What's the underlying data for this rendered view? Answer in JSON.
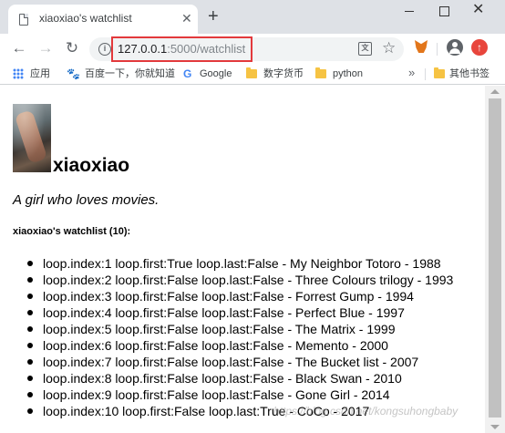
{
  "browser": {
    "tab": {
      "title": "xiaoxiao's watchlist",
      "close_glyph": "✕"
    },
    "new_tab_glyph": "+",
    "window": {
      "close_glyph": "✕"
    },
    "nav": {
      "back": "←",
      "forward": "→",
      "reload": "↻"
    },
    "address": {
      "host": "127.0.0.1",
      "path": ":5000/watchlist",
      "info_glyph": "i"
    },
    "translate_glyph": "文",
    "star_glyph": "☆",
    "update_glyph": "↑"
  },
  "bookmarks": {
    "items": [
      {
        "label": "应用",
        "icon": "apps-icon"
      },
      {
        "label": "百度一下，你就知道",
        "icon": "baidu-paw-icon",
        "glyph": "🐾"
      },
      {
        "label": "Google",
        "icon": "google-icon",
        "glyph": "G"
      },
      {
        "label": "数字货币",
        "icon": "folder-icon"
      },
      {
        "label": "python",
        "icon": "folder-icon"
      }
    ],
    "more_glyph": "»",
    "other": {
      "label": "其他书签",
      "icon": "folder-icon"
    }
  },
  "page": {
    "username": "xiaoxiao",
    "bio": "A girl who loves movies.",
    "list_heading": "xiaoxiao's watchlist (10):",
    "movies": [
      "loop.index:1 loop.first:True loop.last:False - My Neighbor Totoro - 1988",
      "loop.index:2 loop.first:False loop.last:False - Three Colours trilogy - 1993",
      "loop.index:3 loop.first:False loop.last:False - Forrest Gump - 1994",
      "loop.index:4 loop.first:False loop.last:False - Perfect Blue - 1997",
      "loop.index:5 loop.first:False loop.last:False - The Matrix - 1999",
      "loop.index:6 loop.first:False loop.last:False - Memento - 2000",
      "loop.index:7 loop.first:False loop.last:False - The Bucket list - 2007",
      "loop.index:8 loop.first:False loop.last:False - Black Swan - 2010",
      "loop.index:9 loop.first:False loop.last:False - Gone Girl - 2014",
      "loop.index:10 loop.first:False loop.last:True - CoCo - 2017"
    ]
  },
  "watermark": "https://blog.csdn.net/kongsuhongbaby",
  "colors": {
    "url_highlight": "#e3393c",
    "tab_bar": "#dee1e6",
    "update_badge": "#e8453c"
  }
}
